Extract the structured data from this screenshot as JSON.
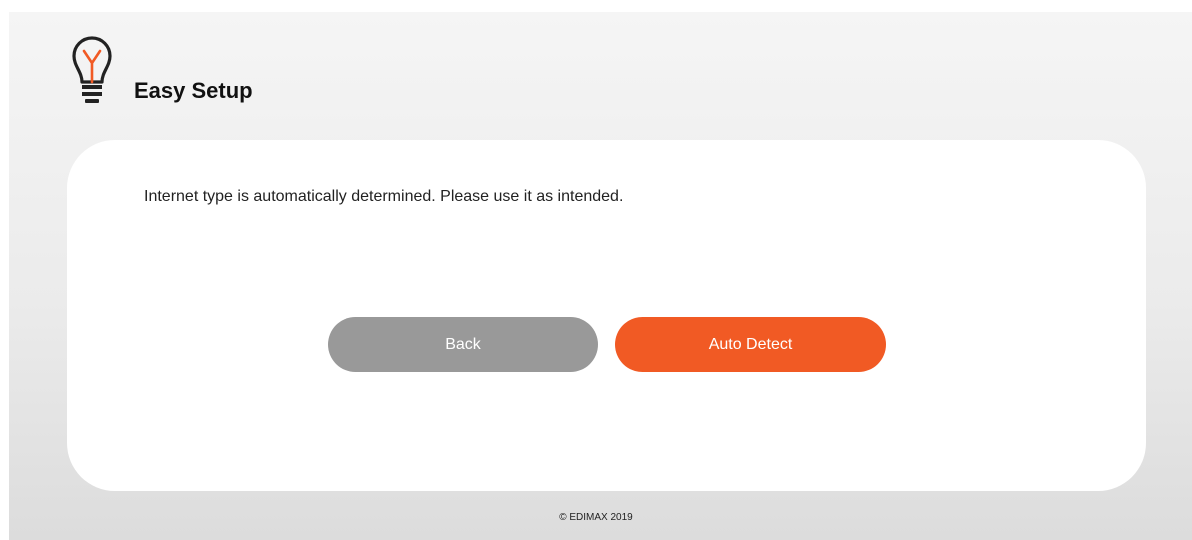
{
  "header": {
    "title": "Easy Setup",
    "icon": "lightbulb-icon",
    "icon_accent": "#f15a24"
  },
  "main": {
    "message": "Internet type is automatically determined. Please use it as intended.",
    "buttons": {
      "back_label": "Back",
      "auto_detect_label": "Auto Detect"
    }
  },
  "footer": {
    "copyright": "© EDIMAX 2019"
  },
  "colors": {
    "accent": "#f15a24",
    "secondary_button": "#999999"
  }
}
